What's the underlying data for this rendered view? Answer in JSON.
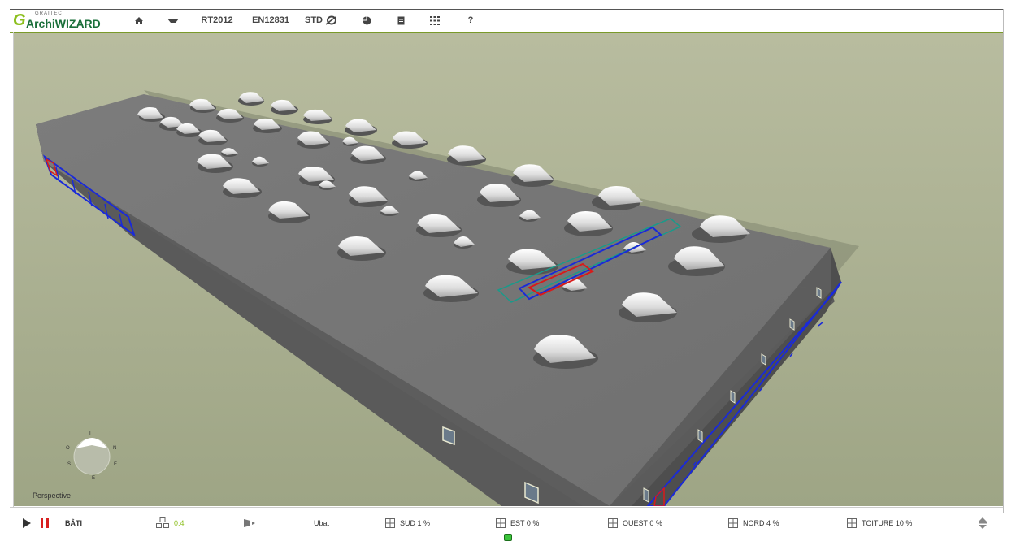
{
  "app": {
    "brand_small": "GRAITEC",
    "brand_name": "ArchiWIZARD",
    "brand_mark": "G"
  },
  "toolbar": {
    "items": [
      {
        "icon": "home-icon"
      },
      {
        "icon": "eye-icon"
      },
      {
        "label": "RT2012"
      },
      {
        "label": "EN12831"
      },
      {
        "label": "STD"
      },
      {
        "icon": "pie-chart-icon"
      },
      {
        "icon": "document-icon"
      },
      {
        "icon": "grid-icon"
      },
      {
        "label": "?"
      }
    ]
  },
  "viewport": {
    "view_mode": "Perspective",
    "compass": {
      "n": "N",
      "s": "S",
      "e": "E",
      "o": "O",
      "top": "I"
    }
  },
  "statusbar": {
    "building_label": "BÂTI",
    "rooms_value": "0.4",
    "sun_label": "Ubat",
    "facades": [
      {
        "label": "SUD 1 %"
      },
      {
        "label": "EST 0 %"
      },
      {
        "label": "OUEST 0 %"
      },
      {
        "label": "NORD 4 %"
      },
      {
        "label": "TOITURE 10 %"
      }
    ]
  },
  "colors": {
    "accent_green": "#8cbf1e",
    "brand_dark_green": "#1a6f3a",
    "ground": "#a9ae8f",
    "roof": "#767676",
    "wall_front": "#555555",
    "wall_side": "#4a4a4a",
    "selection_blue": "#1a2ad8",
    "selection_red": "#d81a1a",
    "selection_teal": "#1a9a8a",
    "pause_red": "#d82020"
  }
}
